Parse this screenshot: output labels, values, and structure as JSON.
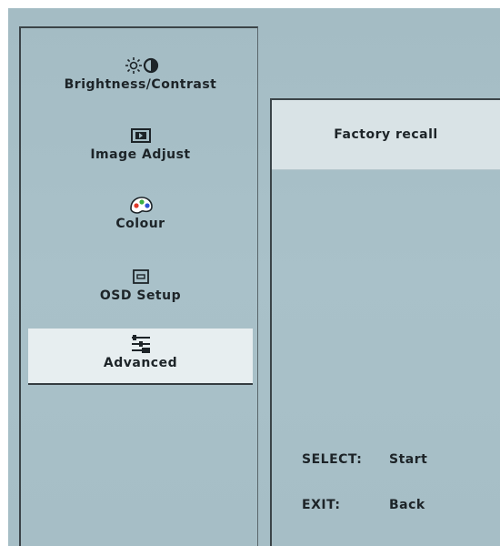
{
  "menu": {
    "items": [
      {
        "id": "brightness",
        "label": "Brightness/Contrast",
        "icon": "sun-half-circle-icon"
      },
      {
        "id": "image",
        "label": "Image Adjust",
        "icon": "image-adjust-icon"
      },
      {
        "id": "colour",
        "label": "Colour",
        "icon": "colour-palette-icon"
      },
      {
        "id": "osd",
        "label": "OSD Setup",
        "icon": "osd-monitor-icon"
      },
      {
        "id": "advanced",
        "label": "Advanced",
        "icon": "advanced-sliders-icon",
        "selected": true
      }
    ]
  },
  "submenu": {
    "title": "Factory recall",
    "select_key": "SELECT:",
    "select_action": "Start",
    "exit_key": "EXIT:",
    "exit_action": "Back"
  },
  "colors": {
    "background": "#a6bec6",
    "highlight": "#e7eef0",
    "header": "#d9e3e6",
    "text": "#1d2428"
  }
}
